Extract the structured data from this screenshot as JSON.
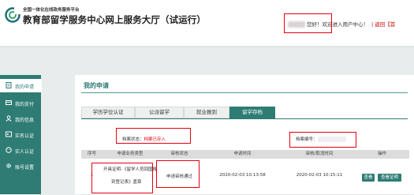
{
  "header": {
    "platform": "全国一体化在线政务服务平台",
    "title": "教育部留学服务中心网上服务大厅（试运行）",
    "greeting": "您好！",
    "welcome": "欢迎进入用户中心！",
    "back": "返回【首"
  },
  "sidebar": {
    "items": [
      {
        "label": "我的申请",
        "icon": "document-icon"
      },
      {
        "label": "我的支付",
        "icon": "wallet-icon"
      },
      {
        "label": "我的信息",
        "icon": "user-info-icon"
      },
      {
        "label": "实名认证",
        "icon": "id-card-icon"
      },
      {
        "label": "实人认证",
        "icon": "face-icon"
      },
      {
        "label": "账号设置",
        "icon": "gear-icon"
      }
    ]
  },
  "main": {
    "title": "我的申请",
    "tabs": [
      "学历学位认证",
      "公派留学",
      "就业报到",
      "留学存档"
    ],
    "filters": {
      "status_label": "档案状态：",
      "status_value": "档案已存入",
      "code_label": "档案编号："
    },
    "table": {
      "headers": [
        "序号",
        "申请业务类型",
        "审核状态",
        "申请时间",
        "审核/取消时间",
        "操作"
      ],
      "row": {
        "index": "1",
        "type_line1": "开具证明-《留学人员回国报",
        "type_line2": "到登记表》盖章",
        "status": "申请审核通过",
        "apply_time": "2020-02-03 10:13:58",
        "review_time": "2020-02-03 10:15:11",
        "action_view": "查看",
        "action_cert": "查看证明"
      }
    }
  },
  "colors": {
    "brand_green": "#2e7c74",
    "highlight_red": "#e60012"
  }
}
